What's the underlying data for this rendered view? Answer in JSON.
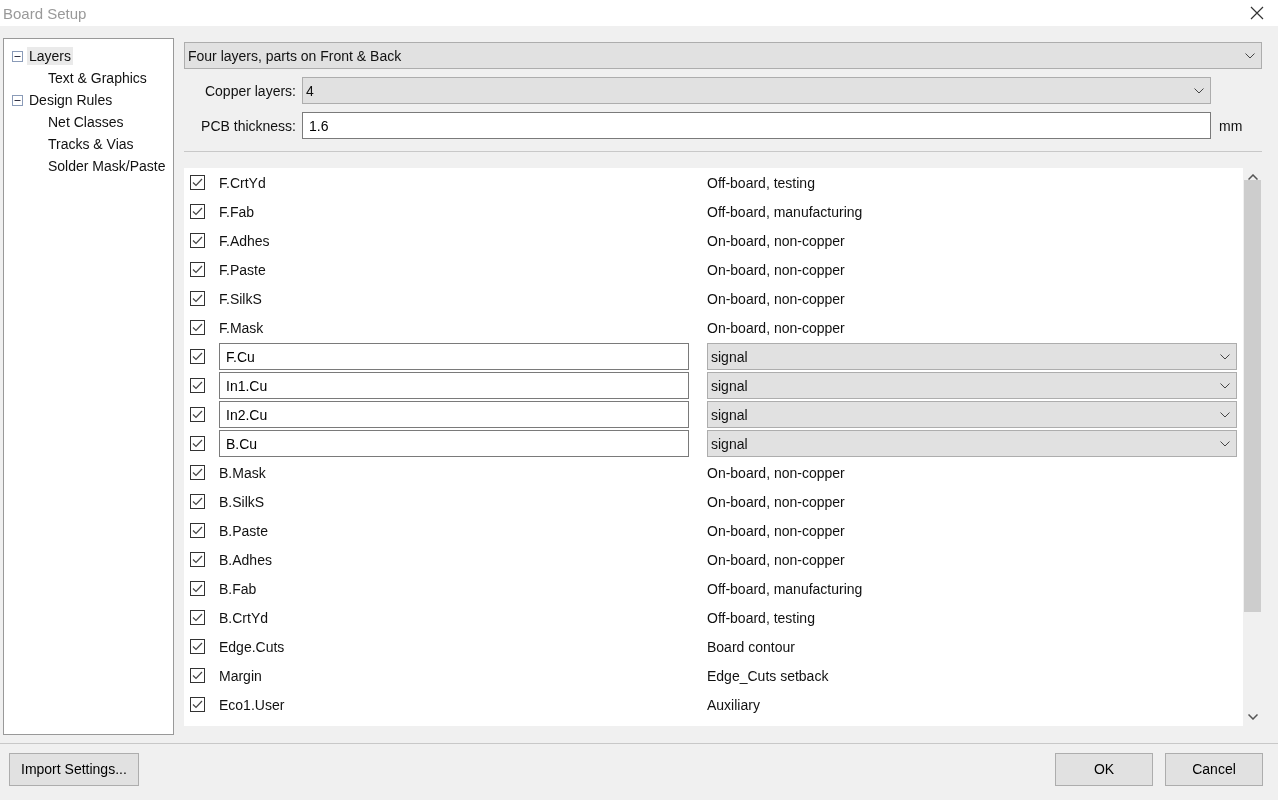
{
  "window": {
    "title": "Board Setup"
  },
  "tree": [
    {
      "label": "Layers",
      "selected": true,
      "expanded": true,
      "children": [
        {
          "label": "Text & Graphics",
          "selected": false
        }
      ]
    },
    {
      "label": "Design Rules",
      "selected": false,
      "expanded": true,
      "children": [
        {
          "label": "Net Classes",
          "selected": false
        },
        {
          "label": "Tracks & Vias",
          "selected": false
        },
        {
          "label": "Solder Mask/Paste",
          "selected": false
        }
      ]
    }
  ],
  "preset": {
    "value": "Four layers, parts on Front & Back"
  },
  "copper_layers": {
    "label": "Copper layers:",
    "value": "4"
  },
  "pcb_thickness": {
    "label": "PCB thickness:",
    "value": "1.6",
    "unit": "mm"
  },
  "layers": [
    {
      "kind": "fixed",
      "checked": true,
      "name": "F.CrtYd",
      "description": "Off-board, testing"
    },
    {
      "kind": "fixed",
      "checked": true,
      "name": "F.Fab",
      "description": "Off-board, manufacturing"
    },
    {
      "kind": "fixed",
      "checked": true,
      "name": "F.Adhes",
      "description": "On-board, non-copper"
    },
    {
      "kind": "fixed",
      "checked": true,
      "name": "F.Paste",
      "description": "On-board, non-copper"
    },
    {
      "kind": "fixed",
      "checked": true,
      "name": "F.SilkS",
      "description": "On-board, non-copper"
    },
    {
      "kind": "fixed",
      "checked": true,
      "name": "F.Mask",
      "description": "On-board, non-copper"
    },
    {
      "kind": "copper",
      "checked": true,
      "name": "F.Cu",
      "description": "signal"
    },
    {
      "kind": "copper",
      "checked": true,
      "name": "In1.Cu",
      "description": "signal"
    },
    {
      "kind": "copper",
      "checked": true,
      "name": "In2.Cu",
      "description": "signal"
    },
    {
      "kind": "copper",
      "checked": true,
      "name": "B.Cu",
      "description": "signal"
    },
    {
      "kind": "fixed",
      "checked": true,
      "name": "B.Mask",
      "description": "On-board, non-copper"
    },
    {
      "kind": "fixed",
      "checked": true,
      "name": "B.SilkS",
      "description": "On-board, non-copper"
    },
    {
      "kind": "fixed",
      "checked": true,
      "name": "B.Paste",
      "description": "On-board, non-copper"
    },
    {
      "kind": "fixed",
      "checked": true,
      "name": "B.Adhes",
      "description": "On-board, non-copper"
    },
    {
      "kind": "fixed",
      "checked": true,
      "name": "B.Fab",
      "description": "Off-board, manufacturing"
    },
    {
      "kind": "fixed",
      "checked": true,
      "name": "B.CrtYd",
      "description": "Off-board, testing"
    },
    {
      "kind": "fixed",
      "checked": true,
      "name": "Edge.Cuts",
      "description": "Board contour"
    },
    {
      "kind": "fixed",
      "checked": true,
      "name": "Margin",
      "description": "Edge_Cuts setback"
    },
    {
      "kind": "fixed",
      "checked": true,
      "name": "Eco1.User",
      "description": "Auxiliary"
    }
  ],
  "buttons": {
    "import": "Import Settings...",
    "ok": "OK",
    "cancel": "Cancel"
  }
}
